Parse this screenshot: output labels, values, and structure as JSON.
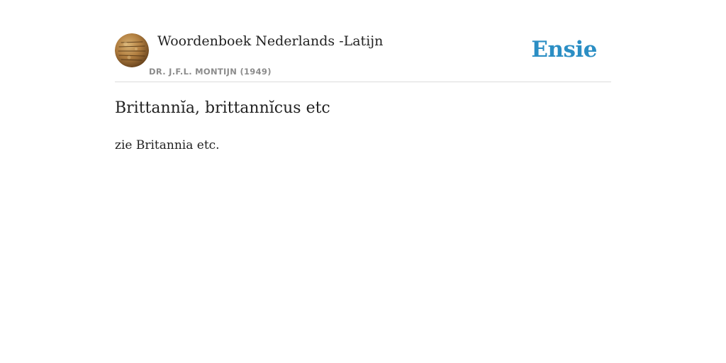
{
  "header": {
    "dictionary_title": "Woordenboek Nederlands -Latijn",
    "author": "DR. J.F.L. MONTIJN (1949)",
    "brand": "Ensie",
    "logo_icon": "inscription-coin-icon"
  },
  "entry": {
    "headword": "Brittannĭa, brittannĭcus etc",
    "definition": "zie Britannia etc."
  },
  "colors": {
    "brand": "#2b8ec4",
    "text": "#222222",
    "muted": "#8c8c8c",
    "divider": "#dcdcdc"
  }
}
